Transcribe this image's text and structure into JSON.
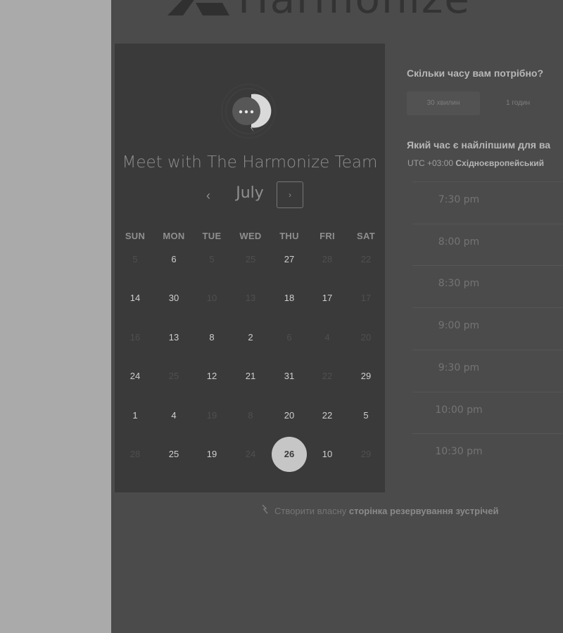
{
  "brand": {
    "name": "Harmonize"
  },
  "calendar": {
    "title": "Meet with The Harmonize Team",
    "month": "July",
    "prev_icon": "‹",
    "next_icon": "›",
    "weekdays": [
      "SUN",
      "MON",
      "TUE",
      "WED",
      "THU",
      "FRI",
      "SAT"
    ],
    "weeks": [
      [
        {
          "d": "5",
          "dim": true
        },
        {
          "d": "6",
          "dim": false
        },
        {
          "d": "5",
          "dim": true
        },
        {
          "d": "25",
          "dim": true
        },
        {
          "d": "27",
          "dim": false
        },
        {
          "d": "28",
          "dim": true
        },
        {
          "d": "22",
          "dim": true
        }
      ],
      [
        {
          "d": "14",
          "dim": false
        },
        {
          "d": "30",
          "dim": false
        },
        {
          "d": "10",
          "dim": true
        },
        {
          "d": "13",
          "dim": true
        },
        {
          "d": "18",
          "dim": false
        },
        {
          "d": "17",
          "dim": false
        },
        {
          "d": "17",
          "dim": true
        }
      ],
      [
        {
          "d": "16",
          "dim": true
        },
        {
          "d": "13",
          "dim": false
        },
        {
          "d": "8",
          "dim": false
        },
        {
          "d": "2",
          "dim": false
        },
        {
          "d": "6",
          "dim": true
        },
        {
          "d": "4",
          "dim": true
        },
        {
          "d": "20",
          "dim": true
        }
      ],
      [
        {
          "d": "24",
          "dim": false
        },
        {
          "d": "25",
          "dim": true
        },
        {
          "d": "12",
          "dim": false
        },
        {
          "d": "21",
          "dim": false
        },
        {
          "d": "31",
          "dim": false
        },
        {
          "d": "22",
          "dim": true
        },
        {
          "d": "29",
          "dim": false
        }
      ],
      [
        {
          "d": "1",
          "dim": false
        },
        {
          "d": "4",
          "dim": false
        },
        {
          "d": "19",
          "dim": true
        },
        {
          "d": "8",
          "dim": true
        },
        {
          "d": "20",
          "dim": false
        },
        {
          "d": "22",
          "dim": false
        },
        {
          "d": "5",
          "dim": false
        }
      ],
      [
        {
          "d": "28",
          "dim": true
        },
        {
          "d": "25",
          "dim": false
        },
        {
          "d": "19",
          "dim": false
        },
        {
          "d": "24",
          "dim": true
        },
        {
          "d": "26",
          "dim": false,
          "selected": true
        },
        {
          "d": "10",
          "dim": false
        },
        {
          "d": "29",
          "dim": true
        }
      ]
    ]
  },
  "duration": {
    "question": "Скільки часу вам потрібно?",
    "options": [
      {
        "label": "30 хвилин",
        "selected": true
      },
      {
        "label": "1 годин",
        "selected": false
      }
    ]
  },
  "time": {
    "question": "Який час є найліпшим для ва",
    "tz_offset": "UTC +03:00",
    "tz_name": "Східноєвропейський",
    "slots": [
      "7:30 pm",
      "8:00 pm",
      "8:30 pm",
      "9:00 pm",
      "9:30 pm",
      "10:00 pm",
      "10:30 pm"
    ]
  },
  "footer": {
    "prefix": "Створити власну",
    "link": "сторінка резервування зустрічей"
  },
  "colors": {
    "page_bg": "#4b4b4b",
    "card_bg": "#3a3a3a",
    "selected_day": "#c6c6c6"
  }
}
